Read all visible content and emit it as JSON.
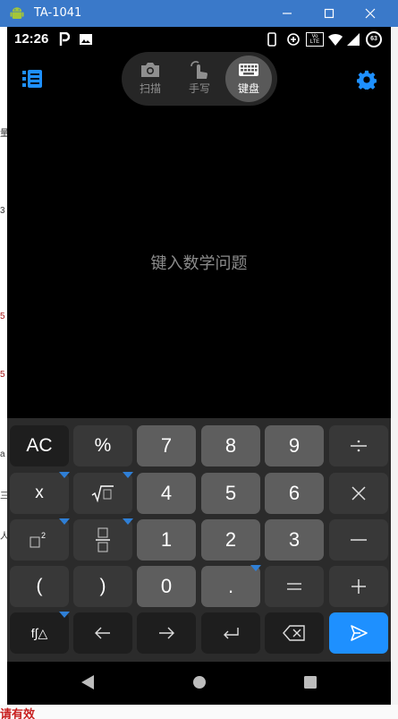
{
  "window": {
    "title": "TA-1041"
  },
  "status_bar": {
    "time": "12:26",
    "volte_label": "Vo LTE",
    "battery_level": "63"
  },
  "modes": [
    {
      "id": "scan",
      "label": "扫描",
      "icon": "camera-icon"
    },
    {
      "id": "handwrite",
      "label": "手写",
      "icon": "hand-write-icon"
    },
    {
      "id": "keyboard",
      "label": "键盘",
      "icon": "keyboard-icon",
      "active": true
    }
  ],
  "input": {
    "placeholder": "键入数学问题"
  },
  "keys": {
    "ac": "AC",
    "percent": "%",
    "n7": "7",
    "n8": "8",
    "n9": "9",
    "x": "x",
    "n4": "4",
    "n5": "5",
    "n6": "6",
    "n1": "1",
    "n2": "2",
    "n3": "3",
    "open_paren": "(",
    "close_paren": ")",
    "n0": "0",
    "dot": ".",
    "func": "f∫△"
  },
  "background_text": {
    "bottom_fragment": "请有效"
  },
  "colors": {
    "accent": "#1e90ff",
    "titlebar": "#3a79c9"
  }
}
